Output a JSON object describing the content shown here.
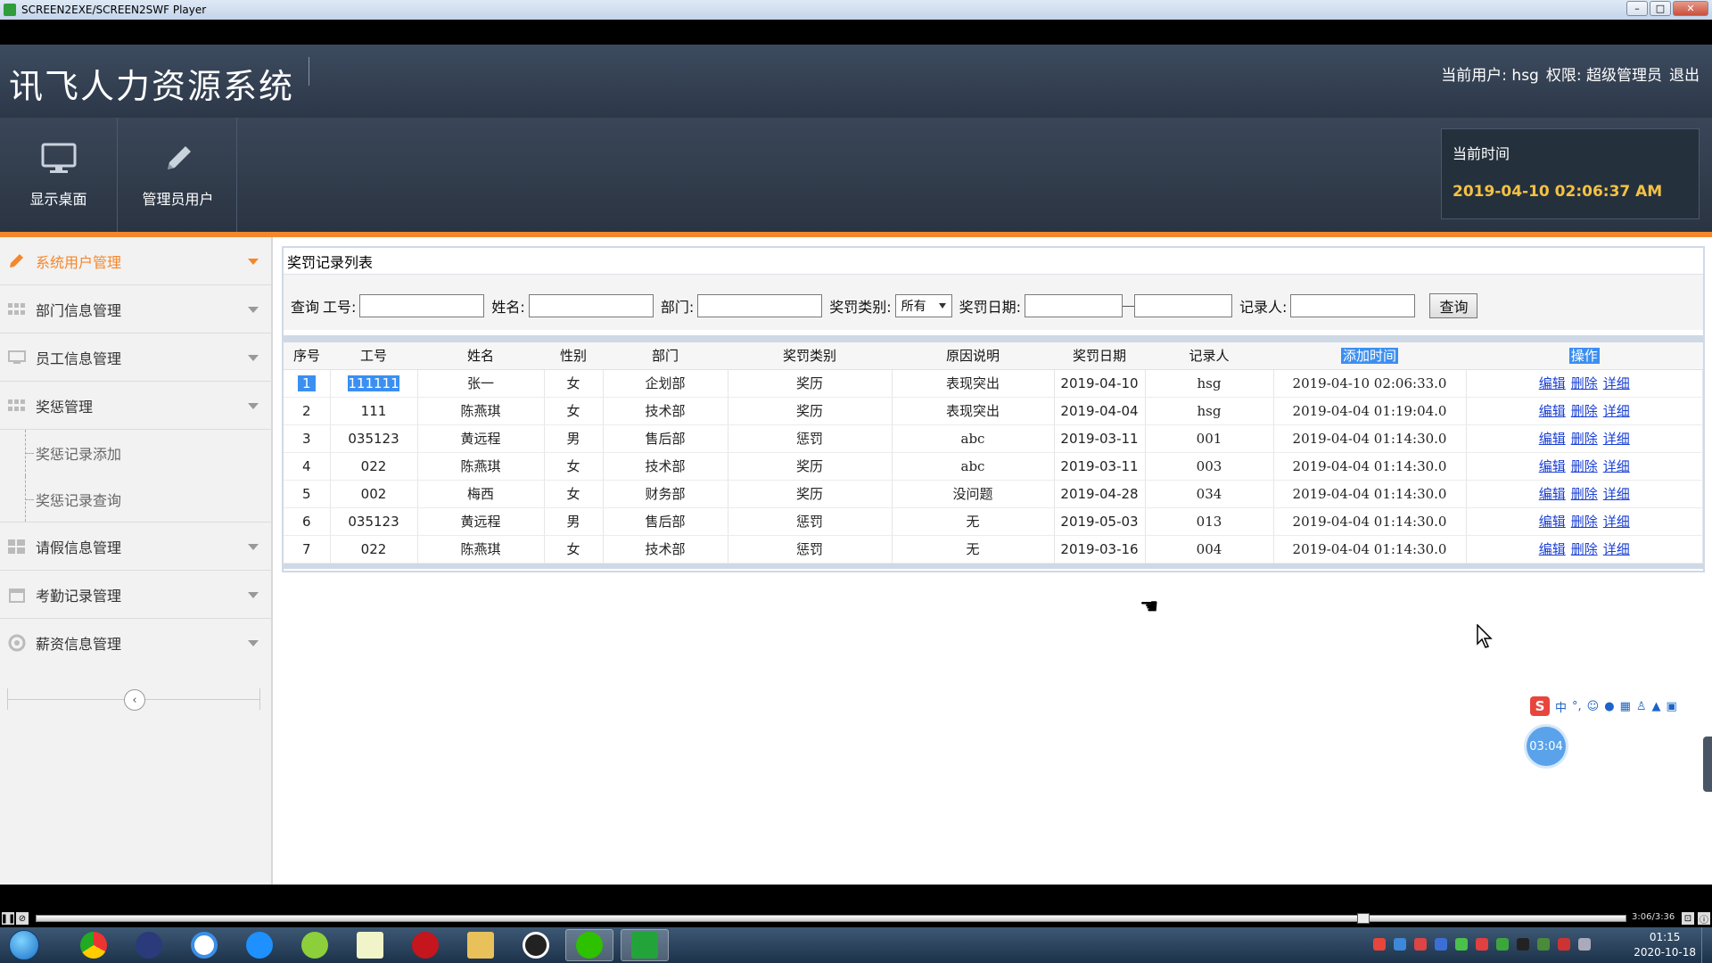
{
  "player": {
    "title": "SCREEN2EXE/SCREEN2SWF Player",
    "minimize": "–",
    "maximize": "□",
    "close": "✕",
    "playback_time": "3:06/3:36",
    "progress": 0.83
  },
  "header": {
    "app_title": "讯飞人力资源系统",
    "user_label": "当前用户:",
    "user_name": "hsg",
    "role_label": "权限:",
    "role_value": "超级管理员",
    "logout": "退出"
  },
  "toolbar": {
    "buttons": [
      {
        "label": "显示桌面",
        "icon": "monitor-icon"
      },
      {
        "label": "管理员用户",
        "icon": "pencil-icon"
      }
    ],
    "time_label": "当前时间",
    "time_value": "2019-04-10 02:06:37 AM"
  },
  "sidebar": {
    "items": [
      {
        "label": "系统用户管理",
        "icon": "pencil-icon",
        "active": true
      },
      {
        "label": "部门信息管理",
        "icon": "grid-icon"
      },
      {
        "label": "员工信息管理",
        "icon": "monitor-icon"
      },
      {
        "label": "奖惩管理",
        "icon": "grid-icon"
      },
      {
        "label": "请假信息管理",
        "icon": "grid-icon"
      },
      {
        "label": "考勤记录管理",
        "icon": "calendar-icon"
      },
      {
        "label": "薪资信息管理",
        "icon": "gear-icon"
      }
    ],
    "sub_items": [
      "奖惩记录添加",
      "奖惩记录查询"
    ],
    "collapse": "‹"
  },
  "panel": {
    "title": "奖罚记录列表",
    "filter": {
      "query_label": "查询",
      "emp_id_label": "工号:",
      "name_label": "姓名:",
      "dept_label": "部门:",
      "type_label": "奖罚类别:",
      "type_selected": "所有",
      "date_label": "奖罚日期:",
      "recorder_label": "记录人:",
      "search_button": "查询"
    },
    "columns": [
      "序号",
      "工号",
      "姓名",
      "性别",
      "部门",
      "奖罚类别",
      "原因说明",
      "奖罚日期",
      "记录人",
      "添加时间",
      "操作"
    ],
    "ops": [
      "编辑",
      "删除",
      "详细"
    ],
    "rows": [
      [
        "1",
        "111111",
        "张一",
        "女",
        "企划部",
        "奖历",
        "表现突出",
        "2019-04-10",
        "hsg",
        "2019-04-10 02:06:33.0"
      ],
      [
        "2",
        "111",
        "陈燕琪",
        "女",
        "技术部",
        "奖历",
        "表现突出",
        "2019-04-04",
        "hsg",
        "2019-04-04 01:19:04.0"
      ],
      [
        "3",
        "035123",
        "黄远程",
        "男",
        "售后部",
        "惩罚",
        "abc",
        "2019-03-11",
        "001",
        "2019-04-04 01:14:30.0"
      ],
      [
        "4",
        "022",
        "陈燕琪",
        "女",
        "技术部",
        "奖历",
        "abc",
        "2019-03-11",
        "003",
        "2019-04-04 01:14:30.0"
      ],
      [
        "5",
        "002",
        "梅西",
        "女",
        "财务部",
        "奖历",
        "没问题",
        "2019-04-28",
        "034",
        "2019-04-04 01:14:30.0"
      ],
      [
        "6",
        "035123",
        "黄远程",
        "男",
        "售后部",
        "惩罚",
        "无",
        "2019-05-03",
        "013",
        "2019-04-04 01:14:30.0"
      ],
      [
        "7",
        "022",
        "陈燕琪",
        "女",
        "技术部",
        "惩罚",
        "无",
        "2019-03-16",
        "004",
        "2019-04-04 01:14:30.0"
      ]
    ]
  },
  "overlay": {
    "ime_logo": "S",
    "ime_mode": "中",
    "timer": "03:04"
  },
  "taskbar": {
    "time": "01:15",
    "date": "2020-10-18"
  }
}
